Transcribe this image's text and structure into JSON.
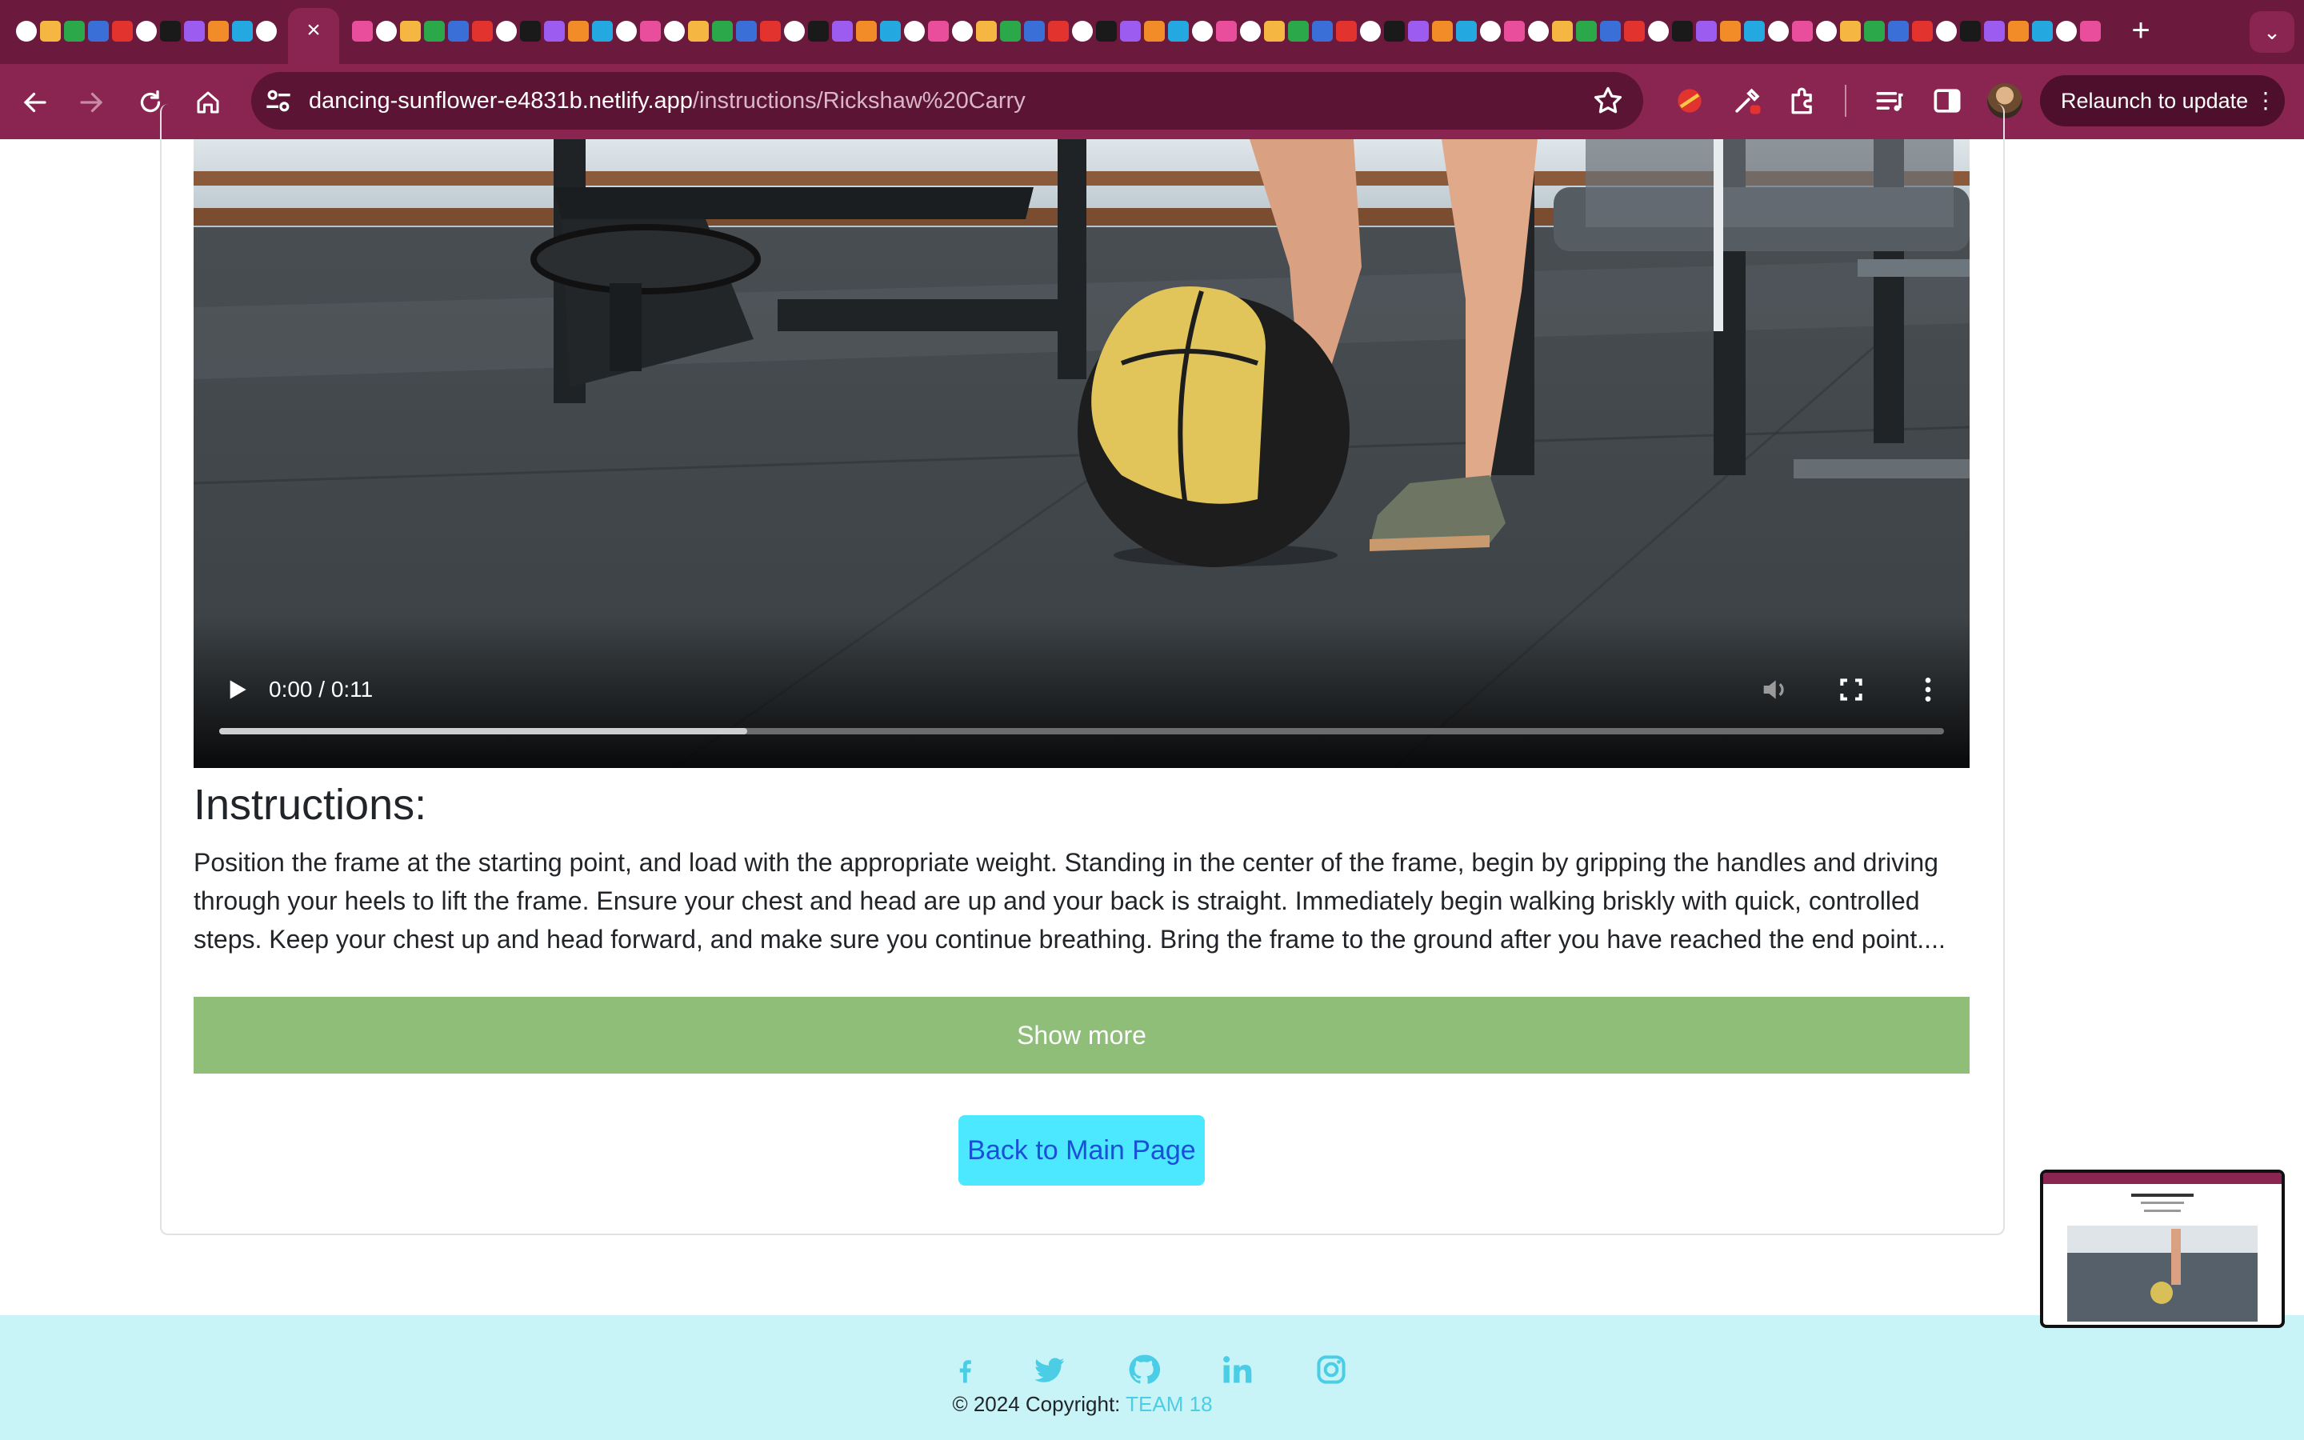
{
  "browser": {
    "url_host": "dancing-sunflower-e4831b.netlify.app",
    "url_path": "/instructions/Rickshaw%20Carry",
    "relaunch_label": "Relaunch to update",
    "accent_color": "#8a2450"
  },
  "video": {
    "time": "0:00 / 0:11",
    "progress": 0.306
  },
  "instructions": {
    "heading": "Instructions:",
    "body": "Position the frame at the starting point, and load with the appropriate weight. Standing in the center of the frame, begin by gripping the handles and driving through your heels to lift the frame. Ensure your chest and head are up and your back is straight. Immediately begin walking briskly with quick, controlled steps. Keep your chest up and head forward, and make sure you continue breathing. Bring the frame to the ground after you have reached the end point....",
    "show_more_label": "Show more",
    "show_more_color": "#8fbe79"
  },
  "back_button": {
    "label": "Back to Main Page",
    "color": "#4ce8ff"
  },
  "footer": {
    "copyright_prefix": "© 2024 Copyright: ",
    "team": "TEAM 18",
    "social_icons": [
      "facebook-icon",
      "twitter-icon",
      "github-icon",
      "linkedin-icon",
      "instagram-icon"
    ],
    "background": "#c8f4f8"
  }
}
